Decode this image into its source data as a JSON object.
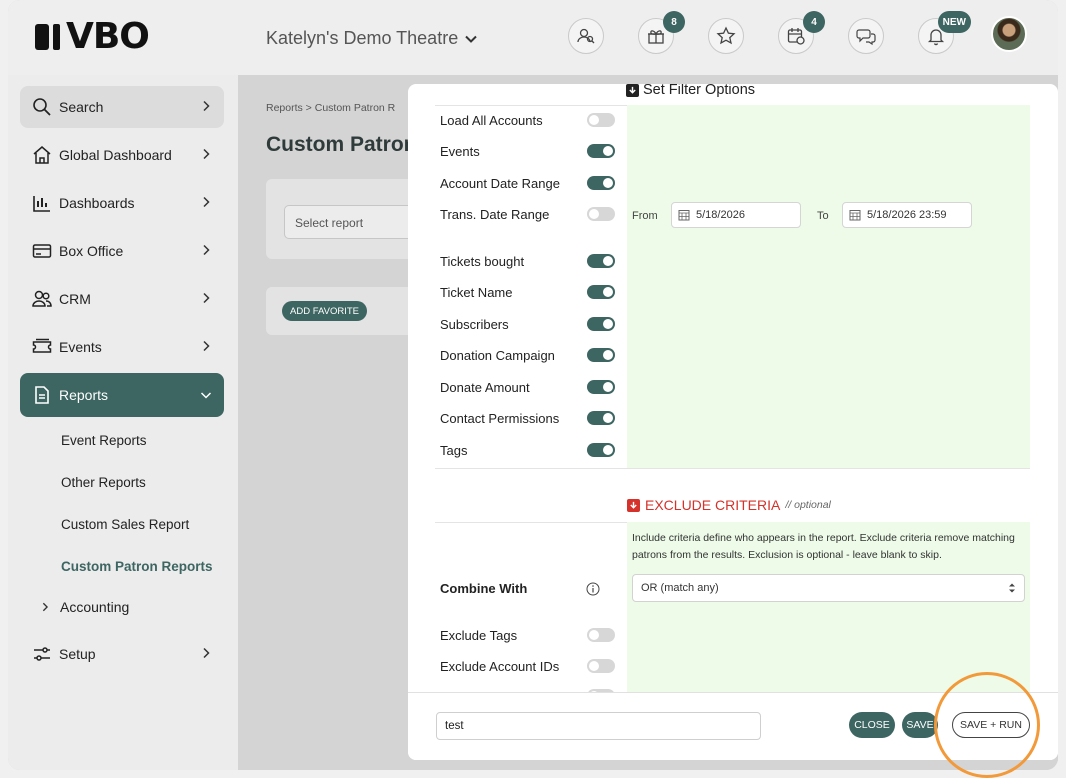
{
  "header": {
    "logo_text": "VBO",
    "theatre_name": "Katelyn's Demo Theatre",
    "icons": [
      {
        "name": "patrons-icon",
        "badge": ""
      },
      {
        "name": "gift-icon",
        "badge": "8"
      },
      {
        "name": "star-icon",
        "badge": ""
      },
      {
        "name": "calendar-icon",
        "badge": "4"
      },
      {
        "name": "chat-icon",
        "badge": ""
      },
      {
        "name": "bell-icon",
        "badge": "NEW"
      }
    ]
  },
  "sidebar": {
    "items": [
      {
        "label": "Search"
      },
      {
        "label": "Global Dashboard"
      },
      {
        "label": "Dashboards"
      },
      {
        "label": "Box Office"
      },
      {
        "label": "CRM"
      },
      {
        "label": "Events"
      },
      {
        "label": "Reports"
      }
    ],
    "reports_sub": [
      "Event Reports",
      "Other Reports",
      "Custom Sales Report",
      "Custom Patron Reports"
    ],
    "accounting": "Accounting",
    "setup": "Setup"
  },
  "main": {
    "breadcrumb": "Reports  >  Custom Patron R",
    "title": "Custom Patron",
    "select_report_placeholder": "Select report",
    "add_favorite": "ADD FAVORITE"
  },
  "modal": {
    "title": "Set Filter Options",
    "filters": [
      {
        "label": "Load All Accounts",
        "on": false
      },
      {
        "label": "Events",
        "on": true
      },
      {
        "label": "Account Date Range",
        "on": true
      },
      {
        "label": "Trans. Date Range",
        "on": false
      },
      {
        "label": "Tickets bought",
        "on": true
      },
      {
        "label": "Ticket Name",
        "on": true
      },
      {
        "label": "Subscribers",
        "on": true
      },
      {
        "label": "Donation Campaign",
        "on": true
      },
      {
        "label": "Donate Amount",
        "on": true
      },
      {
        "label": "Contact Permissions",
        "on": true
      },
      {
        "label": "Tags",
        "on": true
      }
    ],
    "date_from_label": "From",
    "date_from": "5/18/2026",
    "date_to_label": "To",
    "date_to": "5/18/2026 23:59",
    "exclude_title": "EXCLUDE CRITERIA",
    "exclude_optional": "// optional",
    "exclude_help": "Include criteria define who appears in the report. Exclude criteria remove matching patrons from the results. Exclusion is optional - leave blank to skip.",
    "combine_label": "Combine With",
    "combine_value": "OR (match any)",
    "exclude_filters": [
      {
        "label": "Exclude Tags",
        "on": false
      },
      {
        "label": "Exclude Account IDs",
        "on": false
      }
    ],
    "report_name": "test",
    "close_label": "CLOSE",
    "save_label": "SAVE",
    "save_run_label": "SAVE + RUN"
  },
  "colors": {
    "primary": "#3d6562",
    "exclude_red": "#d4322a",
    "panel_green": "#edfbe8",
    "highlight_ring": "#f2993a"
  }
}
